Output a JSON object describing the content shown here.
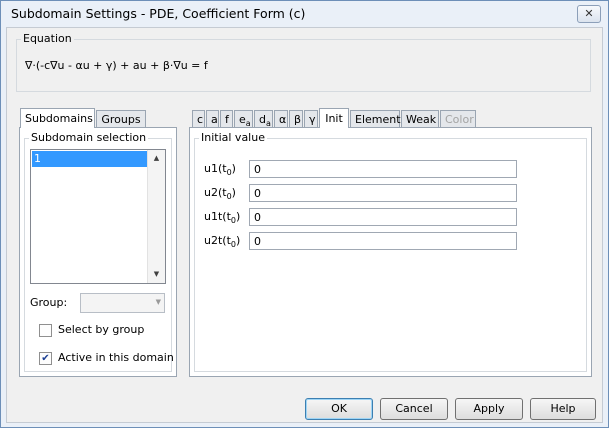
{
  "window": {
    "title": "Subdomain Settings - PDE, Coefficient Form (c)",
    "close_glyph": "✕"
  },
  "equation": {
    "group_label": "Equation",
    "text": "∇·(-c∇u - αu + γ) + au + β·∇u = f"
  },
  "left_tabs": [
    {
      "label": "Subdomains",
      "active": true
    },
    {
      "label": "Groups",
      "active": false
    }
  ],
  "subdomain": {
    "group_label": "Subdomain selection",
    "items": [
      "1"
    ],
    "selected": "1",
    "group_label_text": "Group:",
    "group_value": "",
    "select_by_group_label": "Select by group",
    "select_by_group_checked": false,
    "active_label": "Active in this domain",
    "active_checked": true
  },
  "coef_tabs": [
    {
      "label": "c",
      "sub": "",
      "active": false,
      "disabled": false
    },
    {
      "label": "a",
      "sub": "",
      "active": false,
      "disabled": false
    },
    {
      "label": "f",
      "sub": "",
      "active": false,
      "disabled": false
    },
    {
      "label": "e",
      "sub": "a",
      "active": false,
      "disabled": false
    },
    {
      "label": "d",
      "sub": "a",
      "active": false,
      "disabled": false
    },
    {
      "label": "α",
      "sub": "",
      "active": false,
      "disabled": false
    },
    {
      "label": "β",
      "sub": "",
      "active": false,
      "disabled": false
    },
    {
      "label": "γ",
      "sub": "",
      "active": false,
      "disabled": false
    },
    {
      "label": "Init",
      "sub": "",
      "active": true,
      "disabled": false
    },
    {
      "label": "Element",
      "sub": "",
      "active": false,
      "disabled": false
    },
    {
      "label": "Weak",
      "sub": "",
      "active": false,
      "disabled": false
    },
    {
      "label": "Color",
      "sub": "",
      "active": false,
      "disabled": true
    }
  ],
  "init": {
    "group_label": "Initial value",
    "fields": [
      {
        "label": "u1(t",
        "sub": "0",
        "close": ")",
        "value": "0"
      },
      {
        "label": "u2(t",
        "sub": "0",
        "close": ")",
        "value": "0"
      },
      {
        "label": "u1t(t",
        "sub": "0",
        "close": ")",
        "value": "0"
      },
      {
        "label": "u2t(t",
        "sub": "0",
        "close": ")",
        "value": "0"
      }
    ]
  },
  "buttons": {
    "ok": "OK",
    "cancel": "Cancel",
    "apply": "Apply",
    "help": "Help"
  },
  "colors": {
    "selection": "#3399ff",
    "window_frame": "#6d8fb8",
    "dialog_bg": "#f0f0f0"
  }
}
